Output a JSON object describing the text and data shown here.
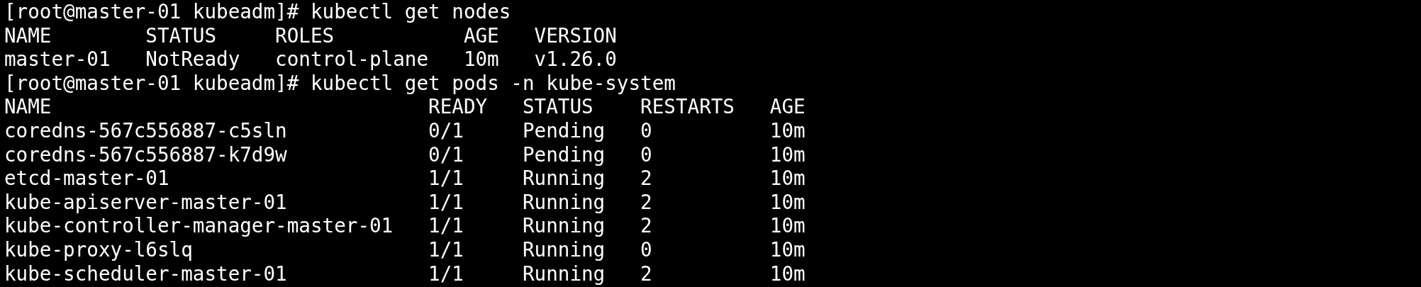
{
  "terminal": {
    "blocks": [
      {
        "kind": "command",
        "text": "[root@master-01 kubeadm]# kubectl get nodes"
      },
      {
        "kind": "table",
        "columns": [
          "NAME",
          "STATUS",
          "ROLES",
          "AGE",
          "VERSION"
        ],
        "rows": [
          [
            "master-01",
            "NotReady",
            "control-plane",
            "10m",
            "v1.26.0"
          ]
        ]
      },
      {
        "kind": "command",
        "text": "[root@master-01 kubeadm]# kubectl get pods -n kube-system"
      },
      {
        "kind": "table",
        "columns": [
          "NAME",
          "READY",
          "STATUS",
          "RESTARTS",
          "AGE"
        ],
        "rows": [
          [
            "coredns-567c556887-c5sln",
            "0/1",
            "Pending",
            "0",
            "10m"
          ],
          [
            "coredns-567c556887-k7d9w",
            "0/1",
            "Pending",
            "0",
            "10m"
          ],
          [
            "etcd-master-01",
            "1/1",
            "Running",
            "2",
            "10m"
          ],
          [
            "kube-apiserver-master-01",
            "1/1",
            "Running",
            "2",
            "10m"
          ],
          [
            "kube-controller-manager-master-01",
            "1/1",
            "Running",
            "2",
            "10m"
          ],
          [
            "kube-proxy-l6slq",
            "1/1",
            "Running",
            "0",
            "10m"
          ],
          [
            "kube-scheduler-master-01",
            "1/1",
            "Running",
            "2",
            "10m"
          ]
        ]
      }
    ]
  }
}
